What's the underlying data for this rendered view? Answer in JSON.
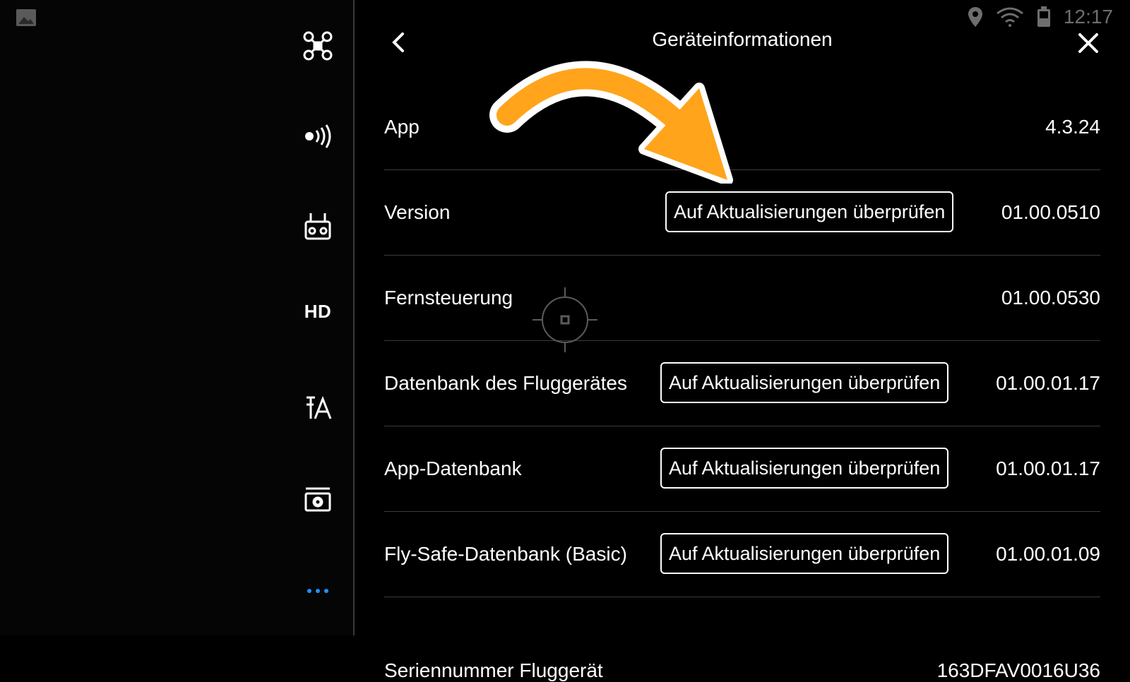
{
  "status_bar": {
    "time": "12:17"
  },
  "header": {
    "title": "Geräteinformationen"
  },
  "sidebar": {
    "icons": [
      "aircraft-icon",
      "signal-icon",
      "remote-controller-icon",
      "hd-icon",
      "translate-icon",
      "camera-icon",
      "more-icon"
    ],
    "hd_label": "HD",
    "accent_color": "#1e90ff"
  },
  "rows": [
    {
      "label": "App",
      "value": "4.3.24"
    },
    {
      "label": "Version",
      "button": "Auf Aktualisierungen überprüfen",
      "value": "01.00.0510"
    },
    {
      "label": "Fernsteuerung",
      "value": "01.00.0530"
    },
    {
      "label": "Datenbank des Fluggerätes",
      "button": "Auf Aktualisierungen überprüfen",
      "value": "01.00.01.17"
    },
    {
      "label": "App-Datenbank",
      "button": "Auf Aktualisierungen überprüfen",
      "value": "01.00.01.17"
    },
    {
      "label": "Fly-Safe-Datenbank (Basic)",
      "button": "Auf Aktualisierungen überprüfen",
      "value": "01.00.01.09"
    },
    {
      "label": "Seriennummer Fluggerät",
      "value": "163DFAV0016U36"
    }
  ],
  "annotation": {
    "arrow_color": "#ffa41b"
  }
}
